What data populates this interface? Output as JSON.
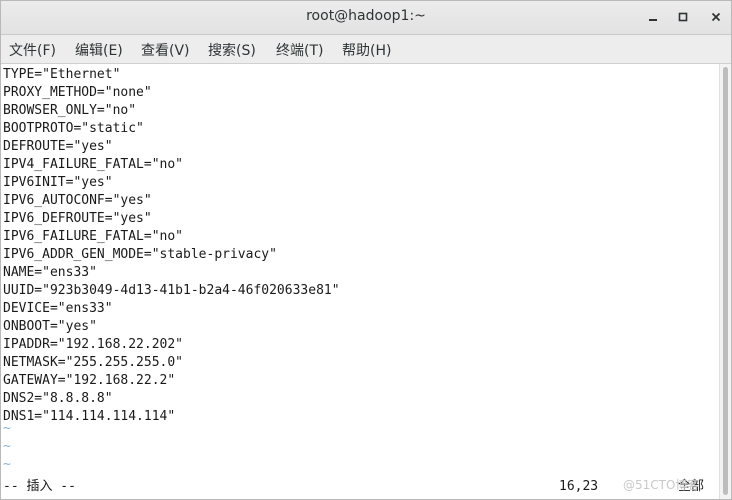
{
  "window": {
    "title": "root@hadoop1:~"
  },
  "menu": {
    "items": [
      {
        "label": "文件(F)"
      },
      {
        "label": "编辑(E)"
      },
      {
        "label": "查看(V)"
      },
      {
        "label": "搜索(S)"
      },
      {
        "label": "终端(T)"
      },
      {
        "label": "帮助(H)"
      }
    ]
  },
  "terminal": {
    "lines": [
      "TYPE=\"Ethernet\"",
      "PROXY_METHOD=\"none\"",
      "BROWSER_ONLY=\"no\"",
      "BOOTPROTO=\"static\"",
      "DEFROUTE=\"yes\"",
      "IPV4_FAILURE_FATAL=\"no\"",
      "IPV6INIT=\"yes\"",
      "IPV6_AUTOCONF=\"yes\"",
      "IPV6_DEFROUTE=\"yes\"",
      "IPV6_FAILURE_FATAL=\"no\"",
      "IPV6_ADDR_GEN_MODE=\"stable-privacy\"",
      "NAME=\"ens33\"",
      "UUID=\"923b3049-4d13-41b1-b2a4-46f020633e81\"",
      "DEVICE=\"ens33\"",
      "ONBOOT=\"yes\"",
      "IPADDR=\"192.168.22.202\"",
      "NETMASK=\"255.255.255.0\"",
      "GATEWAY=\"192.168.22.2\"",
      "DNS2=\"8.8.8.8\"",
      "DNS1=\"114.114.114.114\""
    ],
    "tildes": [
      "~",
      "~",
      "~"
    ],
    "status": {
      "mode": "-- 插入 --",
      "position": "16,23",
      "percent": "全部"
    },
    "watermark": "@51CTO博客"
  },
  "colors": {
    "tilde": "#87b3d6",
    "text": "#1a1a1a",
    "menubar": "#ededed"
  }
}
